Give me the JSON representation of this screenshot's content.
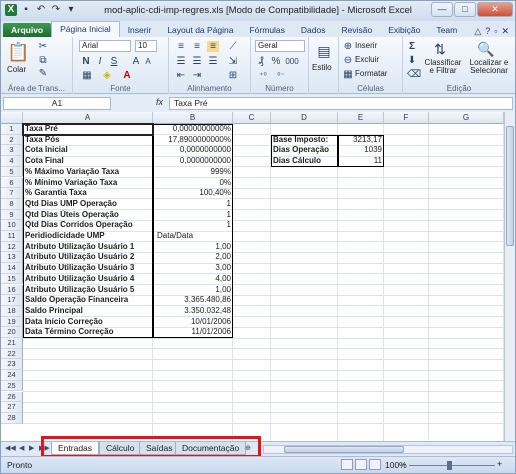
{
  "window": {
    "title": "mod-aplic-cdi-imp-regres.xls [Modo de Compatibilidade] - Microsoft Excel",
    "buttons": {
      "minimize": "—",
      "maximize": "□",
      "close": "✕"
    }
  },
  "ribbon": {
    "tabs": [
      "Arquivo",
      "Página Inicial",
      "Inserir",
      "Layout da Página",
      "Fórmulas",
      "Dados",
      "Revisão",
      "Exibição",
      "Team"
    ],
    "active_tab": "Página Inicial",
    "groups": {
      "clipboard": {
        "name": "Área de Trans...",
        "paste": "Colar"
      },
      "font": {
        "name": "Fonte",
        "font_name": "Arial",
        "font_size": "10",
        "bold": "N",
        "italic": "I",
        "underline": "S"
      },
      "alignment": {
        "name": "Alinhamento"
      },
      "number": {
        "name": "Número",
        "format": "Geral",
        "percent": "%",
        "thousands": "000"
      },
      "styles": {
        "label": "Estilo"
      },
      "cells": {
        "name": "Células",
        "insert": "Inserir",
        "delete": "Excluir",
        "format": "Formatar"
      },
      "editing": {
        "name": "Edição",
        "sort": "Classificar e Filtrar",
        "find": "Localizar e Selecionar",
        "sum": "Σ"
      }
    }
  },
  "formula_bar": {
    "name_box": "A1",
    "fx": "fx",
    "content": "Taxa Pré"
  },
  "columns": [
    "A",
    "B",
    "C",
    "D",
    "E",
    "F",
    "G"
  ],
  "rows": [
    "1",
    "2",
    "3",
    "4",
    "5",
    "6",
    "7",
    "8",
    "9",
    "10",
    "11",
    "12",
    "13",
    "14",
    "15",
    "16",
    "17",
    "18",
    "19",
    "20",
    "21",
    "22",
    "23",
    "24",
    "25",
    "26",
    "27",
    "28"
  ],
  "table_left": [
    {
      "label": "Taxa Pré",
      "value": "0,0000000000%"
    },
    {
      "label": "Taxa Pós",
      "value": "17,8900000000%"
    },
    {
      "label": "Cota Inicial",
      "value": "0,0000000000"
    },
    {
      "label": "Cota Final",
      "value": "0,0000000000"
    },
    {
      "label": "% Máximo Variação Taxa",
      "value": "999%"
    },
    {
      "label": "% Mínimo Variação Taxa",
      "value": "0%"
    },
    {
      "label": "% Garantia Taxa",
      "value": "100,40%"
    },
    {
      "label": "Qtd Dias UMP Operação",
      "value": "1"
    },
    {
      "label": "Qtd Dias Úteis Operação",
      "value": "1"
    },
    {
      "label": "Qtd Dias Corridos Operação",
      "value": "1"
    },
    {
      "label": "Peridiodicidade UMP",
      "value": "Data/Data"
    },
    {
      "label": "Atributo Utilização Usuário 1",
      "value": "1,00"
    },
    {
      "label": "Atributo Utilização Usuário 2",
      "value": "2,00"
    },
    {
      "label": "Atributo Utilização Usuário 3",
      "value": "3,00"
    },
    {
      "label": "Atributo Utilização Usuário 4",
      "value": "4,00"
    },
    {
      "label": "Atributo Utilização Usuário 5",
      "value": "1,00"
    },
    {
      "label": "Saldo Operação Financeira",
      "value": "3.365.480,86"
    },
    {
      "label": "Saldo Principal",
      "value": "3.350.032,48"
    },
    {
      "label": "Data Início Correção",
      "value": "10/01/2006"
    },
    {
      "label": "Data Término Correção",
      "value": "11/01/2006"
    }
  ],
  "table_right": [
    {
      "label": "Base Imposto:",
      "value": "3213,17"
    },
    {
      "label": "Dias Operação",
      "value": "1039"
    },
    {
      "label": "Dias Cálculo",
      "value": "11"
    }
  ],
  "sheet_tabs": [
    "Entradas",
    "Cálculo",
    "Saídas",
    "Documentação"
  ],
  "active_sheet": "Entradas",
  "status": {
    "ready": "Pronto",
    "zoom": "100%",
    "minus": "−",
    "plus": "+"
  }
}
